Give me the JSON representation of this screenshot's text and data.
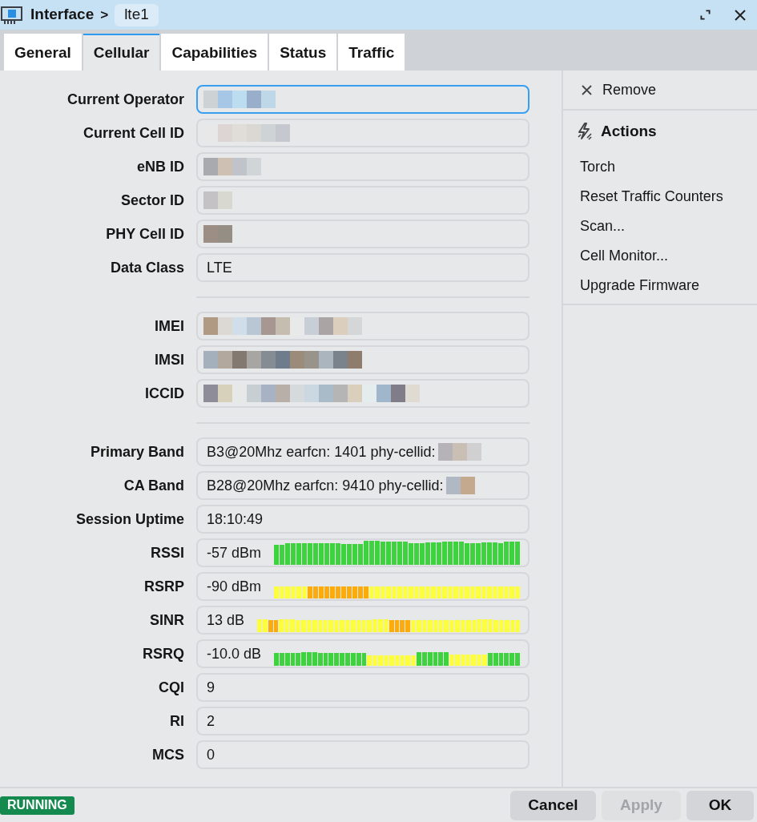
{
  "window": {
    "breadcrumb_parent": "Interface",
    "breadcrumb_separator": ">",
    "breadcrumb_current": "lte1"
  },
  "tabs": [
    {
      "label": "General",
      "selected": false
    },
    {
      "label": "Cellular",
      "selected": true
    },
    {
      "label": "Capabilities",
      "selected": false
    },
    {
      "label": "Status",
      "selected": false
    },
    {
      "label": "Traffic",
      "selected": false
    }
  ],
  "form": {
    "groups": [
      {
        "fields": [
          {
            "label": "Current Operator",
            "kind": "text",
            "redacted": true,
            "focused": true
          },
          {
            "label": "Current Cell ID",
            "kind": "text",
            "redacted": true,
            "focused": false
          },
          {
            "label": "eNB ID",
            "kind": "text",
            "redacted": true,
            "focused": false
          },
          {
            "label": "Sector ID",
            "kind": "text",
            "redacted": true,
            "focused": false
          },
          {
            "label": "PHY Cell ID",
            "kind": "text",
            "redacted": true,
            "focused": false
          },
          {
            "label": "Data Class",
            "kind": "text",
            "value": "LTE",
            "redacted": false,
            "focused": false
          }
        ]
      },
      {
        "fields": [
          {
            "label": "IMEI",
            "kind": "text",
            "redacted": true,
            "focused": false
          },
          {
            "label": "IMSI",
            "kind": "text",
            "redacted": true,
            "focused": false
          },
          {
            "label": "ICCID",
            "kind": "text",
            "redacted": true,
            "focused": false
          }
        ]
      },
      {
        "fields": [
          {
            "label": "Primary Band",
            "kind": "text",
            "value": "B3@20Mhz earfcn: 1401 phy-cellid:",
            "redacted": true,
            "focused": false
          },
          {
            "label": "CA Band",
            "kind": "text",
            "value": "B28@20Mhz earfcn: 9410 phy-cellid:",
            "redacted": true,
            "focused": false
          },
          {
            "label": "Session Uptime",
            "kind": "text",
            "value": "18:10:49",
            "redacted": false,
            "focused": false
          },
          {
            "label": "RSSI",
            "kind": "meter",
            "value": "-57 dBm",
            "redacted": false,
            "focused": false
          },
          {
            "label": "RSRP",
            "kind": "meter",
            "value": "-90 dBm",
            "redacted": false,
            "focused": false
          },
          {
            "label": "SINR",
            "kind": "meter",
            "value": "13 dB",
            "redacted": false,
            "focused": false
          },
          {
            "label": "RSRQ",
            "kind": "meter",
            "value": "-10.0 dB",
            "redacted": false,
            "focused": false
          },
          {
            "label": "CQI",
            "kind": "text",
            "value": "9",
            "redacted": false,
            "focused": false
          },
          {
            "label": "RI",
            "kind": "text",
            "value": "2",
            "redacted": false,
            "focused": false
          },
          {
            "label": "MCS",
            "kind": "text",
            "value": "0",
            "redacted": false,
            "focused": false
          }
        ]
      }
    ]
  },
  "sidebar": {
    "remove_label": "Remove",
    "actions_heading": "Actions",
    "actions": [
      "Torch",
      "Reset Traffic Counters",
      "Scan...",
      "Cell Monitor...",
      "Upgrade Firmware"
    ]
  },
  "footer": {
    "status": "RUNNING",
    "buttons": [
      {
        "label": "Cancel",
        "disabled": false
      },
      {
        "label": "Apply",
        "disabled": true
      },
      {
        "label": "OK",
        "disabled": false
      }
    ]
  }
}
